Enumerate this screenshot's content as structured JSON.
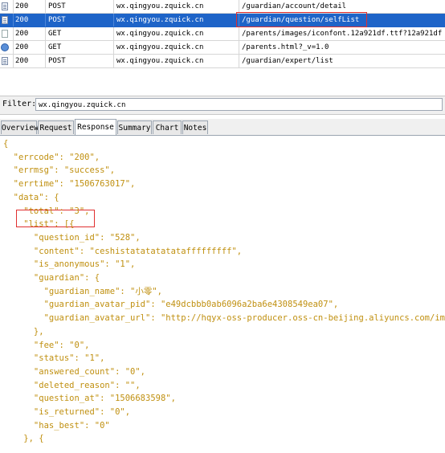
{
  "sessions": [
    {
      "result": "200",
      "protocol": "POST",
      "host": "wx.qingyou.zquick.cn",
      "url": "/guardian/account/detail",
      "icon": "request-doc-icon",
      "selected": false
    },
    {
      "result": "200",
      "protocol": "POST",
      "host": "wx.qingyou.zquick.cn",
      "url": "/guardian/question/selfList",
      "icon": "request-doc-icon",
      "selected": true
    },
    {
      "result": "200",
      "protocol": "GET",
      "host": "wx.qingyou.zquick.cn",
      "url": "/parents/images/iconfont.12a921df.ttf?12a921df",
      "icon": "blank-file-icon",
      "selected": false
    },
    {
      "result": "200",
      "protocol": "GET",
      "host": "wx.qingyou.zquick.cn",
      "url": "/parents.html?_v=1.0",
      "icon": "web-page-icon",
      "selected": false
    },
    {
      "result": "200",
      "protocol": "POST",
      "host": "wx.qingyou.zquick.cn",
      "url": "/guardian/expert/list",
      "icon": "request-doc-icon",
      "selected": false
    }
  ],
  "filter": {
    "label": "Filter:",
    "value": "wx.qingyou.zquick.cn"
  },
  "tabs": [
    {
      "label": "Overview",
      "active": false
    },
    {
      "label": "Request",
      "active": false
    },
    {
      "label": "Response",
      "active": true
    },
    {
      "label": "Summary",
      "active": false
    },
    {
      "label": "Chart",
      "active": false
    },
    {
      "label": "Notes",
      "active": false
    }
  ],
  "response": {
    "lines": [
      "{",
      "  \"errcode\": \"200\",",
      "  \"errmsg\": \"success\",",
      "  \"errtime\": \"1506763017\",",
      "  \"data\": {",
      "    \"total\": \"3\",",
      "    \"list\": [{",
      "      \"question_id\": \"528\",",
      "      \"content\": \"ceshistatatatatatafffffffff\",",
      "      \"is_anonymous\": \"1\",",
      "      \"guardian\": {",
      "        \"guardian_name\": \"小零\",",
      "        \"guardian_avatar_pid\": \"e49dcbbb0ab6096a2ba6e4308549ea07\",",
      "        \"guardian_avatar_url\": \"http://hqyx-oss-producer.oss-cn-beijing.aliyuncs.com/images",
      "      },",
      "      \"fee\": \"0\",",
      "      \"status\": \"1\",",
      "      \"answered_count\": \"0\",",
      "      \"deleted_reason\": \"\",",
      "      \"question_at\": \"1506683598\",",
      "      \"is_returned\": \"0\",",
      "      \"has_best\": \"0\"",
      "    }, {"
    ]
  },
  "colors": {
    "selection": "#1e64c8",
    "highlight_box": "#e03030",
    "json_text": "#c09010"
  }
}
